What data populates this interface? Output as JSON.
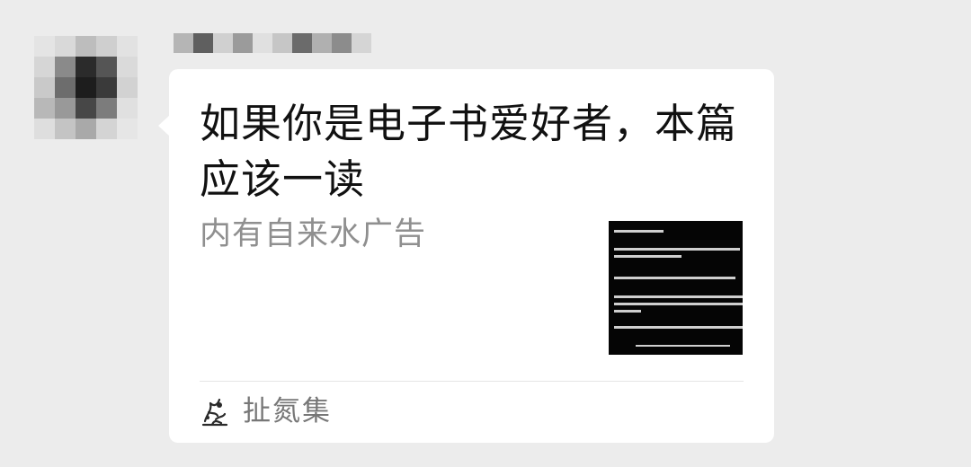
{
  "article_card": {
    "title": "如果你是电子书爱好者，本篇应该一读",
    "description": "内有自来水广告",
    "source_name": "扯氮集"
  },
  "colors": {
    "background": "#ececec",
    "bubble": "#ffffff",
    "title_text": "#111111",
    "description_text": "#8f8f8f",
    "source_text": "#777777"
  },
  "icons": {
    "avatar": "pixelated-avatar",
    "source_logo": "ink-sketch-logo"
  }
}
